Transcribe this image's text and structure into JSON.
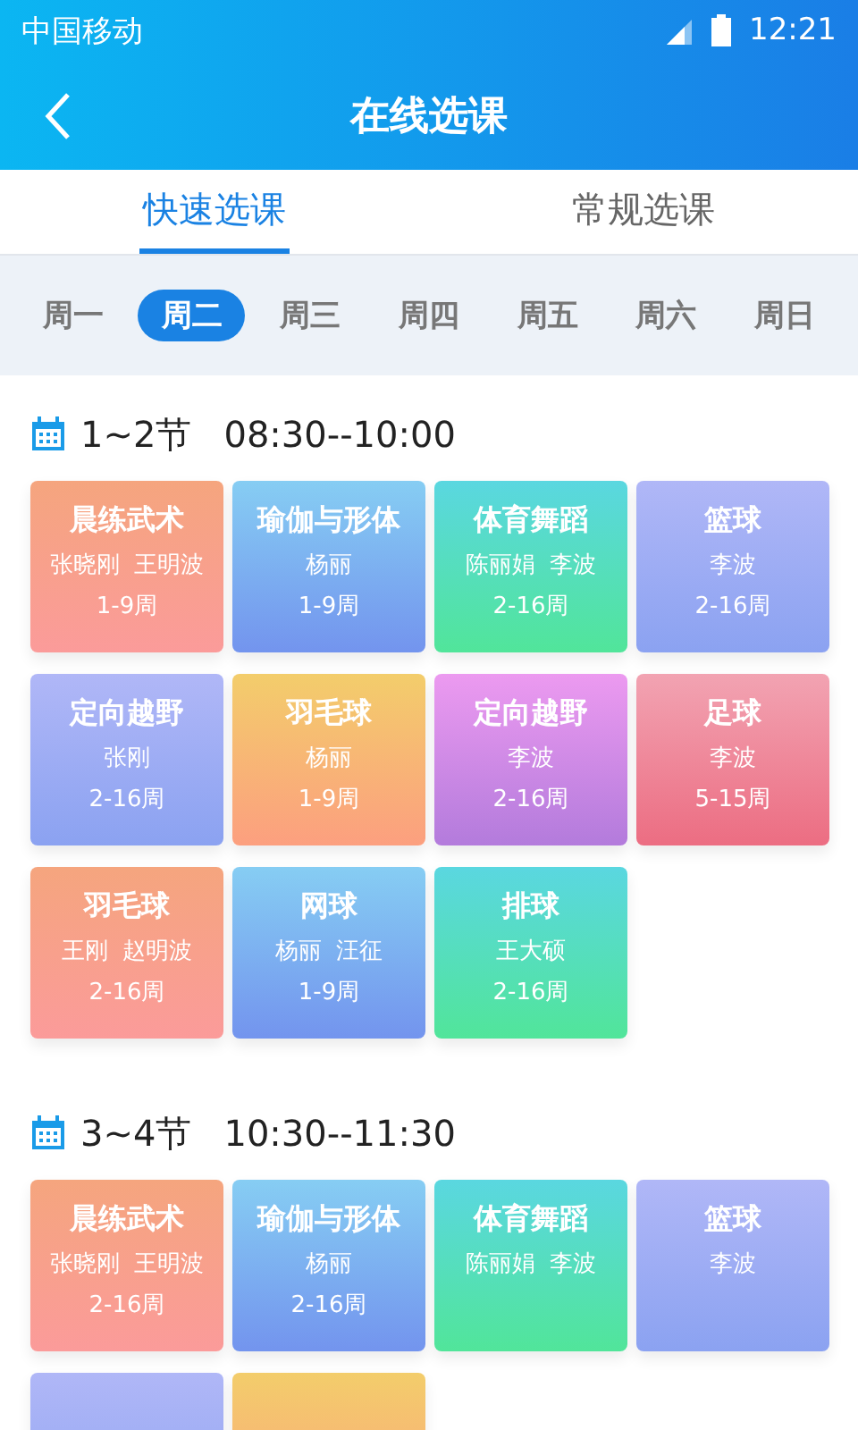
{
  "status_bar": {
    "carrier": "中国移动",
    "time": "12:21"
  },
  "header": {
    "title": "在线选课"
  },
  "tabs": [
    {
      "label": "快速选课",
      "selected": true
    },
    {
      "label": "常规选课",
      "selected": false
    }
  ],
  "days": [
    {
      "label": "周一",
      "selected": false
    },
    {
      "label": "周二",
      "selected": true
    },
    {
      "label": "周三",
      "selected": false
    },
    {
      "label": "周四",
      "selected": false
    },
    {
      "label": "周五",
      "selected": false
    },
    {
      "label": "周六",
      "selected": false
    },
    {
      "label": "周日",
      "selected": false
    }
  ],
  "sections": [
    {
      "period": "1~2节",
      "time": "08:30--10:00",
      "cards": [
        {
          "kind": "coral",
          "title": "晨练武术",
          "teachers": "张晓刚  王明波",
          "weeks": "1-9周"
        },
        {
          "kind": "sky",
          "title": "瑜伽与形体",
          "teachers": "杨丽",
          "weeks": "1-9周"
        },
        {
          "kind": "mint",
          "title": "体育舞蹈",
          "teachers": "陈丽娟  李波",
          "weeks": "2-16周"
        },
        {
          "kind": "periwinkle",
          "title": "篮球",
          "teachers": "李波",
          "weeks": "2-16周"
        },
        {
          "kind": "periwinkle",
          "title": "定向越野",
          "teachers": "张刚",
          "weeks": "2-16周"
        },
        {
          "kind": "amber",
          "title": "羽毛球",
          "teachers": "杨丽",
          "weeks": "1-9周"
        },
        {
          "kind": "violet",
          "title": "定向越野",
          "teachers": "李波",
          "weeks": "2-16周"
        },
        {
          "kind": "rose",
          "title": "足球",
          "teachers": "李波",
          "weeks": "5-15周"
        },
        {
          "kind": "coral",
          "title": "羽毛球",
          "teachers": "王刚  赵明波",
          "weeks": "2-16周"
        },
        {
          "kind": "sky",
          "title": "网球",
          "teachers": "杨丽  汪征",
          "weeks": "1-9周"
        },
        {
          "kind": "mint",
          "title": "排球",
          "teachers": "王大硕",
          "weeks": "2-16周"
        }
      ]
    },
    {
      "period": "3~4节",
      "time": "10:30--11:30",
      "cards": [
        {
          "kind": "coral",
          "title": "晨练武术",
          "teachers": "张晓刚  王明波",
          "weeks": "2-16周"
        },
        {
          "kind": "sky",
          "title": "瑜伽与形体",
          "teachers": "杨丽",
          "weeks": "2-16周"
        },
        {
          "kind": "mint",
          "title": "体育舞蹈",
          "teachers": "陈丽娟  李波"
        },
        {
          "kind": "periwinkle",
          "title": "篮球",
          "teachers": "李波"
        },
        {
          "kind": "periwinkle"
        },
        {
          "kind": "amber"
        }
      ]
    }
  ]
}
